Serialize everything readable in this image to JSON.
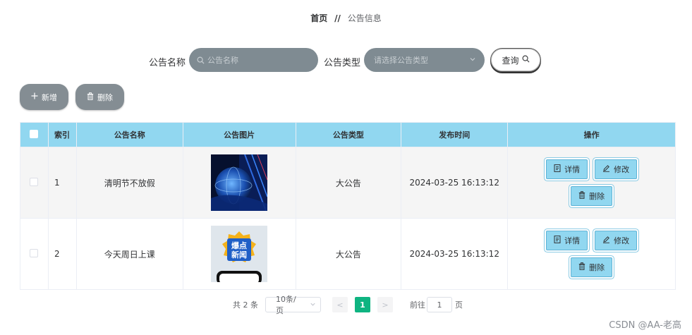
{
  "breadcrumb": {
    "home": "首页",
    "separator": "//",
    "current": "公告信息"
  },
  "search": {
    "name_label": "公告名称",
    "name_placeholder": "公告名称",
    "type_label": "公告类型",
    "type_placeholder": "请选择公告类型",
    "query_button": "查询"
  },
  "toolbar": {
    "add_label": "新增",
    "delete_label": "删除"
  },
  "table": {
    "columns": [
      "索引",
      "公告名称",
      "公告图片",
      "公告类型",
      "发布时间",
      "操作"
    ],
    "rows": [
      {
        "index": "1",
        "name": "清明节不放假",
        "image": "tech-globe-image",
        "type": "大公告",
        "time": "2024-03-25 16:13:12"
      },
      {
        "index": "2",
        "name": "今天周日上课",
        "image": "breaking-news-image",
        "type": "大公告",
        "time": "2024-03-25 16:13:12"
      }
    ],
    "actions": {
      "detail": "详情",
      "edit": "修改",
      "delete": "删除"
    }
  },
  "image_text": {
    "badge_line1": "爆点",
    "badge_line2": "新闻"
  },
  "pagination": {
    "total": "共 2 条",
    "page_size": "10条/页",
    "prev": "<",
    "current_page": "1",
    "next": ">",
    "goto_label": "前往",
    "goto_value": "1",
    "page_suffix": "页"
  },
  "watermark": "CSDN @AA-老高",
  "colors": {
    "header_bg": "#91d7f0",
    "button_gray": "#848d93",
    "active_page": "#0fb481"
  }
}
